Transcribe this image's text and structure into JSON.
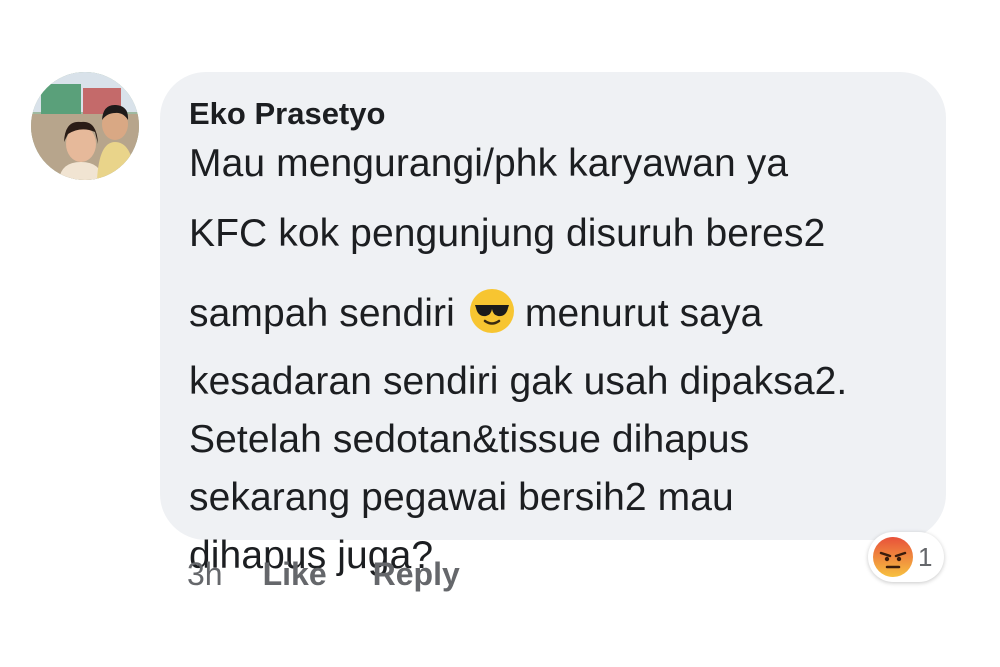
{
  "comment": {
    "author": "Eko Prasetyo",
    "text_lines": [
      "Mau mengurangi/phk karyawan ya",
      "KFC kok pengunjung disuruh beres2",
      "sampah sendiri",
      "menurut saya",
      "kesadaran sendiri gak usah dipaksa2.",
      "Setelah sedotan&tissue dihapus",
      "sekarang pegawai bersih2 mau",
      "dihapus juga?"
    ],
    "inline_emoji": "smiling-face-with-sunglasses-icon"
  },
  "actions": {
    "time": "3h",
    "like_label": "Like",
    "reply_label": "Reply"
  },
  "reactions": {
    "icon": "angry-face-icon",
    "count": "1"
  },
  "colors": {
    "bubble_bg": "#eff1f4",
    "text": "#1c1e21",
    "meta": "#65676b"
  }
}
